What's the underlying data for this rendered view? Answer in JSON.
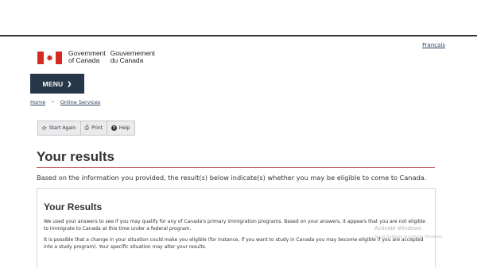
{
  "header": {
    "language_link": "Français",
    "brand_en_line1": "Government",
    "brand_en_line2": "of Canada",
    "brand_fr_line1": "Gouvernement",
    "brand_fr_line2": "du Canada",
    "menu_label": "MENU"
  },
  "breadcrumb": {
    "home": "Home",
    "separator": ">",
    "services": "Online Services"
  },
  "toolbar": {
    "start_again": "Start Again",
    "print": "Print",
    "help": "Help"
  },
  "main": {
    "title": "Your results",
    "intro": "Based on the information you provided, the result(s) below indicate(s) whether you may be eligible to come to Canada.",
    "panel_title": "Your Results",
    "paragraph1": "We used your answers to see if you may qualify for any of Canada's primary immigration programs. Based on your answers, it appears that you are not eligible to immigrate to Canada at this time under a federal program.",
    "paragraph2": "It is possible that a change in your situation could make you eligible (for instance, if you want to study in Canada you may become eligible if you are accepted into a study program). Your specific situation may alter your results."
  },
  "watermark": {
    "line1": "Activate Windows",
    "line2": "Go to Settings to activate Windows."
  },
  "colors": {
    "menu_bg": "#26374a",
    "flag_red": "#d52b1e",
    "title_rule": "#af3c43",
    "link": "#284162"
  },
  "icons": {
    "start_again": "refresh-icon",
    "print": "print-icon",
    "help": "help-icon",
    "menu": "chevron-down-icon"
  }
}
